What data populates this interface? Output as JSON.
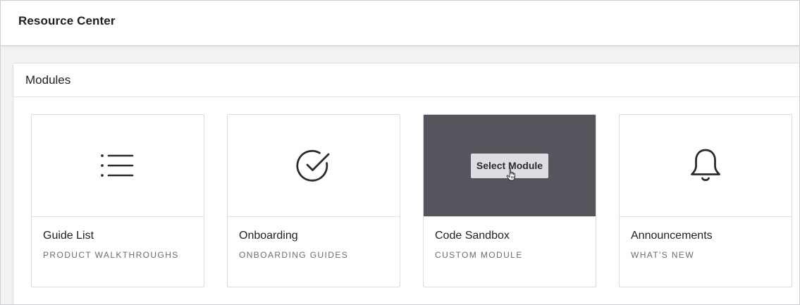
{
  "header": {
    "title": "Resource Center"
  },
  "panel": {
    "title": "Modules"
  },
  "modules": [
    {
      "name": "Guide List",
      "subtitle": "PRODUCT WALKTHROUGHS",
      "icon": "list-icon"
    },
    {
      "name": "Onboarding",
      "subtitle": "ONBOARDING GUIDES",
      "icon": "check-circle-icon"
    },
    {
      "name": "Code Sandbox",
      "subtitle": "CUSTOM MODULE",
      "icon": "none",
      "hovered": true,
      "action_label": "Select Module"
    },
    {
      "name": "Announcements",
      "subtitle": "WHAT'S NEW",
      "icon": "bell-icon"
    }
  ],
  "colors": {
    "hover_overlay": "#55555e",
    "icon_stroke": "#2a2a30"
  }
}
